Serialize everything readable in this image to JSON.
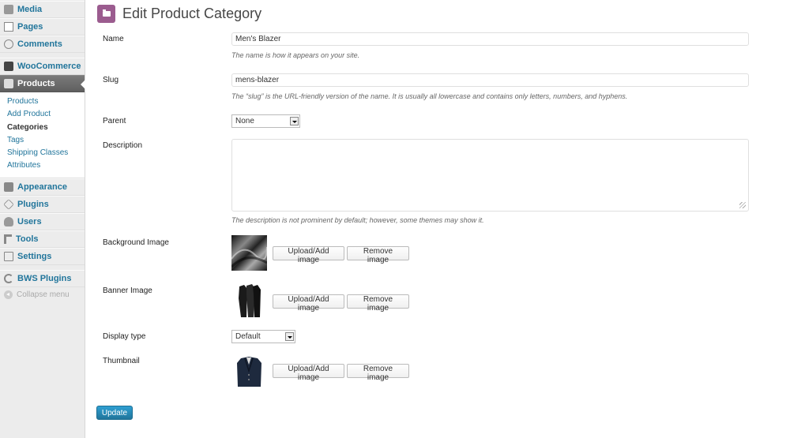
{
  "sidebar": {
    "items": [
      {
        "label": "Media",
        "icon": "media-icon"
      },
      {
        "label": "Pages",
        "icon": "pages-icon"
      },
      {
        "label": "Comments",
        "icon": "comments-icon"
      },
      {
        "label": "WooCommerce",
        "icon": "woocommerce-icon"
      },
      {
        "label": "Products",
        "icon": "products-icon"
      },
      {
        "label": "Appearance",
        "icon": "appearance-icon"
      },
      {
        "label": "Plugins",
        "icon": "plugins-icon"
      },
      {
        "label": "Users",
        "icon": "users-icon"
      },
      {
        "label": "Tools",
        "icon": "tools-icon"
      },
      {
        "label": "Settings",
        "icon": "settings-icon"
      },
      {
        "label": "BWS Plugins",
        "icon": "bws-plugins-icon"
      }
    ],
    "submenu": [
      "Products",
      "Add Product",
      "Categories",
      "Tags",
      "Shipping Classes",
      "Attributes"
    ],
    "active_submenu": "Categories",
    "collapse_label": "Collapse menu",
    "accent_color": "#21759b"
  },
  "page": {
    "title": "Edit Product Category",
    "title_icon_color": "#9b5c8f"
  },
  "form": {
    "name_label": "Name",
    "name_value": "Men's Blazer",
    "name_desc": "The name is how it appears on your site.",
    "slug_label": "Slug",
    "slug_value": "mens-blazer",
    "slug_desc": "The “slug” is the URL-friendly version of the name. It is usually all lowercase and contains only letters, numbers, and hyphens.",
    "parent_label": "Parent",
    "parent_value": "None",
    "description_label": "Description",
    "description_value": "",
    "description_desc": "The description is not prominent by default; however, some themes may show it.",
    "background_image_label": "Background Image",
    "banner_image_label": "Banner Image",
    "display_type_label": "Display type",
    "display_type_value": "Default",
    "thumbnail_label": "Thumbnail",
    "upload_label": "Upload/Add image",
    "remove_label": "Remove image",
    "update_label": "Update"
  }
}
